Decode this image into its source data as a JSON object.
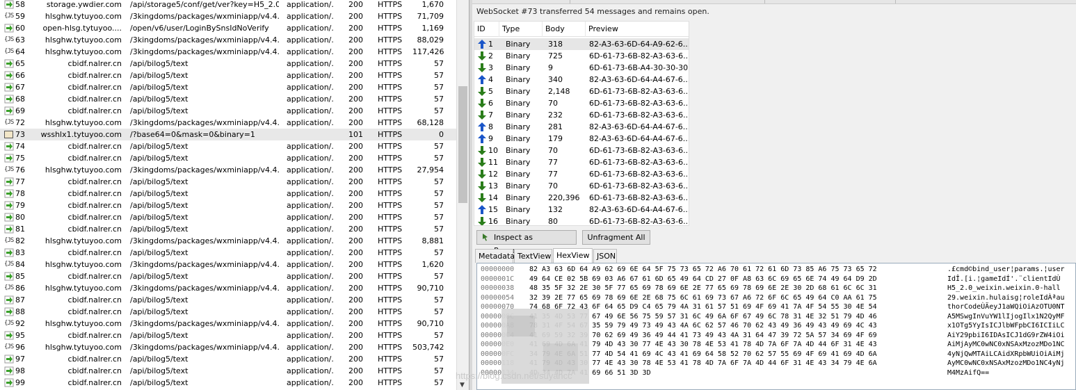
{
  "sessions": {
    "rows": [
      {
        "icon": "arrow",
        "num": "58",
        "host": "storage.ywdier.com",
        "url": "/api/storage5/conf/get/ver?key=H5_2.0_...",
        "ctype": "application/...",
        "result": "200",
        "proto": "HTTPS",
        "body": "1,670"
      },
      {
        "icon": "js",
        "num": "59",
        "host": "hlsghw.tytuyoo.com",
        "url": "/3kingdoms/packages/wxminiapp/v4.4.5/r...",
        "ctype": "application/...",
        "result": "200",
        "proto": "HTTPS",
        "body": "71,709"
      },
      {
        "icon": "arrow",
        "num": "60",
        "host": "open-hlsg.tytuyoo....",
        "url": "/open/v6/user/LoginBySnsIdNoVerify",
        "ctype": "application/...",
        "result": "200",
        "proto": "HTTPS",
        "body": "1,169"
      },
      {
        "icon": "js",
        "num": "63",
        "host": "hlsghw.tytuyoo.com",
        "url": "/3kingdoms/packages/wxminiapp/v4.4.5/r...",
        "ctype": "application/...",
        "result": "200",
        "proto": "HTTPS",
        "body": "88,029"
      },
      {
        "icon": "js",
        "num": "64",
        "host": "hlsghw.tytuyoo.com",
        "url": "/3kingdoms/packages/wxminiapp/v4.4.5/r...",
        "ctype": "application/...",
        "result": "200",
        "proto": "HTTPS",
        "body": "117,426"
      },
      {
        "icon": "arrow",
        "num": "65",
        "host": "cbidf.nalrer.cn",
        "url": "/api/bilog5/text",
        "ctype": "application/...",
        "result": "200",
        "proto": "HTTPS",
        "body": "57"
      },
      {
        "icon": "arrow",
        "num": "66",
        "host": "cbidf.nalrer.cn",
        "url": "/api/bilog5/text",
        "ctype": "application/...",
        "result": "200",
        "proto": "HTTPS",
        "body": "57"
      },
      {
        "icon": "arrow",
        "num": "67",
        "host": "cbidf.nalrer.cn",
        "url": "/api/bilog5/text",
        "ctype": "application/...",
        "result": "200",
        "proto": "HTTPS",
        "body": "57"
      },
      {
        "icon": "arrow",
        "num": "68",
        "host": "cbidf.nalrer.cn",
        "url": "/api/bilog5/text",
        "ctype": "application/...",
        "result": "200",
        "proto": "HTTPS",
        "body": "57"
      },
      {
        "icon": "arrow",
        "num": "69",
        "host": "cbidf.nalrer.cn",
        "url": "/api/bilog5/text",
        "ctype": "application/...",
        "result": "200",
        "proto": "HTTPS",
        "body": "57"
      },
      {
        "icon": "js",
        "num": "72",
        "host": "hlsghw.tytuyoo.com",
        "url": "/3kingdoms/packages/wxminiapp/v4.4.5/r...",
        "ctype": "application/...",
        "result": "200",
        "proto": "HTTPS",
        "body": "68,128"
      },
      {
        "icon": "ws",
        "num": "73",
        "host": "wsshlx1.tytuyoo.com",
        "url": "/?base64=0&mask=0&binary=1",
        "ctype": "",
        "result": "101",
        "proto": "HTTPS",
        "body": "0",
        "selected": true
      },
      {
        "icon": "arrow",
        "num": "74",
        "host": "cbidf.nalrer.cn",
        "url": "/api/bilog5/text",
        "ctype": "application/...",
        "result": "200",
        "proto": "HTTPS",
        "body": "57"
      },
      {
        "icon": "arrow",
        "num": "75",
        "host": "cbidf.nalrer.cn",
        "url": "/api/bilog5/text",
        "ctype": "application/...",
        "result": "200",
        "proto": "HTTPS",
        "body": "57"
      },
      {
        "icon": "js",
        "num": "76",
        "host": "hlsghw.tytuyoo.com",
        "url": "/3kingdoms/packages/wxminiapp/v4.4.5/r...",
        "ctype": "application/...",
        "result": "200",
        "proto": "HTTPS",
        "body": "27,954"
      },
      {
        "icon": "arrow",
        "num": "77",
        "host": "cbidf.nalrer.cn",
        "url": "/api/bilog5/text",
        "ctype": "application/...",
        "result": "200",
        "proto": "HTTPS",
        "body": "57"
      },
      {
        "icon": "arrow",
        "num": "78",
        "host": "cbidf.nalrer.cn",
        "url": "/api/bilog5/text",
        "ctype": "application/...",
        "result": "200",
        "proto": "HTTPS",
        "body": "57"
      },
      {
        "icon": "arrow",
        "num": "79",
        "host": "cbidf.nalrer.cn",
        "url": "/api/bilog5/text",
        "ctype": "application/...",
        "result": "200",
        "proto": "HTTPS",
        "body": "57"
      },
      {
        "icon": "arrow",
        "num": "80",
        "host": "cbidf.nalrer.cn",
        "url": "/api/bilog5/text",
        "ctype": "application/...",
        "result": "200",
        "proto": "HTTPS",
        "body": "57"
      },
      {
        "icon": "arrow",
        "num": "81",
        "host": "cbidf.nalrer.cn",
        "url": "/api/bilog5/text",
        "ctype": "application/...",
        "result": "200",
        "proto": "HTTPS",
        "body": "57"
      },
      {
        "icon": "js",
        "num": "82",
        "host": "hlsghw.tytuyoo.com",
        "url": "/3kingdoms/packages/wxminiapp/v4.4.5/r...",
        "ctype": "application/...",
        "result": "200",
        "proto": "HTTPS",
        "body": "8,881"
      },
      {
        "icon": "arrow",
        "num": "83",
        "host": "cbidf.nalrer.cn",
        "url": "/api/bilog5/text",
        "ctype": "application/...",
        "result": "200",
        "proto": "HTTPS",
        "body": "57"
      },
      {
        "icon": "js",
        "num": "84",
        "host": "hlsghw.tytuyoo.com",
        "url": "/3kingdoms/packages/wxminiapp/v4.4.5/r...",
        "ctype": "application/...",
        "result": "200",
        "proto": "HTTPS",
        "body": "1,620"
      },
      {
        "icon": "arrow",
        "num": "85",
        "host": "cbidf.nalrer.cn",
        "url": "/api/bilog5/text",
        "ctype": "application/...",
        "result": "200",
        "proto": "HTTPS",
        "body": "57"
      },
      {
        "icon": "js",
        "num": "86",
        "host": "hlsghw.tytuyoo.com",
        "url": "/3kingdoms/packages/wxminiapp/v4.4.5/r...",
        "ctype": "application/...",
        "result": "200",
        "proto": "HTTPS",
        "body": "90,710"
      },
      {
        "icon": "arrow",
        "num": "87",
        "host": "cbidf.nalrer.cn",
        "url": "/api/bilog5/text",
        "ctype": "application/...",
        "result": "200",
        "proto": "HTTPS",
        "body": "57"
      },
      {
        "icon": "arrow",
        "num": "88",
        "host": "cbidf.nalrer.cn",
        "url": "/api/bilog5/text",
        "ctype": "application/...",
        "result": "200",
        "proto": "HTTPS",
        "body": "57"
      },
      {
        "icon": "js",
        "num": "92",
        "host": "hlsghw.tytuyoo.com",
        "url": "/3kingdoms/packages/wxminiapp/v4.4.5/r...",
        "ctype": "application/...",
        "result": "200",
        "proto": "HTTPS",
        "body": "90,710"
      },
      {
        "icon": "arrow",
        "num": "95",
        "host": "cbidf.nalrer.cn",
        "url": "/api/bilog5/text",
        "ctype": "application/...",
        "result": "200",
        "proto": "HTTPS",
        "body": "57"
      },
      {
        "icon": "js",
        "num": "96",
        "host": "hlsghw.tytuyoo.com",
        "url": "/3kingdoms/packages/wxminiapp/v4.4.5/r...",
        "ctype": "application/...",
        "result": "200",
        "proto": "HTTPS",
        "body": "503,742"
      },
      {
        "icon": "arrow",
        "num": "97",
        "host": "cbidf.nalrer.cn",
        "url": "/api/bilog5/text",
        "ctype": "application/...",
        "result": "200",
        "proto": "HTTPS",
        "body": "57"
      },
      {
        "icon": "arrow",
        "num": "98",
        "host": "cbidf.nalrer.cn",
        "url": "/api/bilog5/text",
        "ctype": "application/...",
        "result": "200",
        "proto": "HTTPS",
        "body": "57"
      },
      {
        "icon": "arrow",
        "num": "99",
        "host": "cbidf.nalrer.cn",
        "url": "/api/bilog5/text",
        "ctype": "application/...",
        "result": "200",
        "proto": "HTTPS",
        "body": "57"
      }
    ]
  },
  "websocket": {
    "status": "WebSocket #73 transferred 54 messages and remains open.",
    "columns": [
      "ID",
      "Type",
      "Body",
      "Preview"
    ],
    "messages": [
      {
        "dir": "up",
        "id": "1",
        "type": "Binary",
        "body": "318",
        "preview": "82-A3-63-6D-64-A9-62-6...",
        "selected": true
      },
      {
        "dir": "down",
        "id": "2",
        "type": "Binary",
        "body": "725",
        "preview": "6D-61-73-6B-82-A3-63-6..."
      },
      {
        "dir": "down",
        "id": "3",
        "type": "Binary",
        "body": "9",
        "preview": "6D-61-73-6B-A4-30-30-30..."
      },
      {
        "dir": "up",
        "id": "4",
        "type": "Binary",
        "body": "340",
        "preview": "82-A3-63-6D-64-A4-67-6..."
      },
      {
        "dir": "down",
        "id": "5",
        "type": "Binary",
        "body": "2,148",
        "preview": "6D-61-73-6B-82-A3-63-6..."
      },
      {
        "dir": "down",
        "id": "6",
        "type": "Binary",
        "body": "70",
        "preview": "6D-61-73-6B-82-A3-63-6..."
      },
      {
        "dir": "down",
        "id": "7",
        "type": "Binary",
        "body": "232",
        "preview": "6D-61-73-6B-82-A3-63-6..."
      },
      {
        "dir": "up",
        "id": "8",
        "type": "Binary",
        "body": "281",
        "preview": "82-A3-63-6D-64-A4-67-6..."
      },
      {
        "dir": "up",
        "id": "9",
        "type": "Binary",
        "body": "179",
        "preview": "82-A3-63-6D-64-A4-67-6..."
      },
      {
        "dir": "down",
        "id": "10",
        "type": "Binary",
        "body": "70",
        "preview": "6D-61-73-6B-82-A3-63-6..."
      },
      {
        "dir": "down",
        "id": "11",
        "type": "Binary",
        "body": "77",
        "preview": "6D-61-73-6B-82-A3-63-6..."
      },
      {
        "dir": "down",
        "id": "12",
        "type": "Binary",
        "body": "77",
        "preview": "6D-61-73-6B-82-A3-63-6..."
      },
      {
        "dir": "down",
        "id": "13",
        "type": "Binary",
        "body": "70",
        "preview": "6D-61-73-6B-82-A3-63-6..."
      },
      {
        "dir": "down",
        "id": "14",
        "type": "Binary",
        "body": "220,396",
        "preview": "6D-61-73-6B-82-A3-63-6..."
      },
      {
        "dir": "up",
        "id": "15",
        "type": "Binary",
        "body": "132",
        "preview": "82-A3-63-6D-64-A4-67-6..."
      },
      {
        "dir": "down",
        "id": "16",
        "type": "Binary",
        "body": "80",
        "preview": "6D-61-73-6B-82-A3-63-6..."
      }
    ],
    "buttons": {
      "inspect": "Inspect as Response",
      "unfragment": "Unfragment All"
    },
    "tabs": [
      "Metadata",
      "TextView",
      "HexView",
      "JSON"
    ],
    "active_tab": "HexView"
  },
  "hex": {
    "rows": [
      {
        "off": "00000000",
        "bytes": "82 A3 63 6D 64 A9 62 69 6E 64 5F 75 73 65 72 A6 70 61 72 61 6D 73 85 A6 75 73 65 72",
        "ascii": ".£cmd©bind_user¦params.¦user"
      },
      {
        "off": "0000001C",
        "bytes": "49 64 CE 02 5B 69 03 A6 67 61 6D 65 49 64 CD 27 0F A8 63 6C 69 65 6E 74 49 64 D9 2D",
        "ascii": "IdÎ.[i.¦gameIdÍ'.¨clientIdÙ"
      },
      {
        "off": "00000038",
        "bytes": "48 35 5F 32 2E 30 5F 77 65 69 78 69 6E 2E 77 65 69 78 69 6E 2E 30 2D 68 61 6C 6C 31",
        "ascii": "H5_2.0_weixin.weixin.0-hall"
      },
      {
        "off": "00000054",
        "bytes": "32 39 2E 77 65 69 78 69 6E 2E 68 75 6C 61 69 73 67 A6 72 6F 6C 65 49 64 C0 AA 61 75",
        "ascii": "29.weixin.hulaisg¦roleIdÀªau"
      },
      {
        "off": "00000070",
        "bytes": "74 68 6F 72 43 6F 64 65 D9 C4 65 79 4A 31 61 57 51 69 4F 69 41 7A 4F 54 55 30 4E 54",
        "ascii": "thorCodeÙÄeyJ1aWQiOiAzOTU0NT"
      },
      {
        "off": "0000008C",
        "bytes": "41 35 4D 53 77 67 49 6E 56 75 59 57 31 6C 49 6A 6F 67 49 6C 78 31 4E 32 51 79 4D 46",
        "ascii": "A5MSwgInVuYW1lIjogIlx1N2QyMF"
      },
      {
        "off": "000000A8",
        "bytes": "78 31 4F 54 67 35 59 79 49 73 49 43 4A 6C 62 57 46 70 62 43 49 36 49 43 49 69 4C 43",
        "ascii": "x1OTg5YyIsICJlbWFpbCI6ICIiLC"
      },
      {
        "off": "000000C4",
        "bytes": "41 69 59 32 39 70 62 69 49 36 49 44 41 73 49 43 4A 31 64 47 39 72 5A 57 34 69 4F 69",
        "ascii": "AiY29pbiI6IDAsICJ1dG9rZW4iOi"
      },
      {
        "off": "000000E0",
        "bytes": "41 69 4D 6A 41 79 4D 43 30 77 4E 43 30 78 4E 53 41 78 4D 7A 6F 7A 4D 44 6F 31 4E 43",
        "ascii": "AiMjAyMC0wNC0xNSAxMzozMDo1NC"
      },
      {
        "off": "000000FC",
        "bytes": "34 79 4E 6A 51 77 4D 54 41 69 4C 43 41 69 64 58 52 70 62 57 55 69 4F 69 41 69 4D 6A",
        "ascii": "4yNjQwMTAiLCAidXRpbWUiOiAiMj"
      },
      {
        "off": "00000118",
        "bytes": "41 79 4D 43 30 77 4E 43 30 78 4E 53 41 78 4D 7A 6F 7A 4D 44 6F 31 4E 43 34 79 4E 6A",
        "ascii": "AyMC0wNC0xNSAxMzozMDo1NC4yNj"
      },
      {
        "off": "00000134",
        "bytes": "4D 34 4D 7A 41 69 66 51 3D 3D",
        "ascii": "M4MzAifQ=="
      }
    ]
  },
  "watermark": "https://blog.csdn.net/suyancc"
}
